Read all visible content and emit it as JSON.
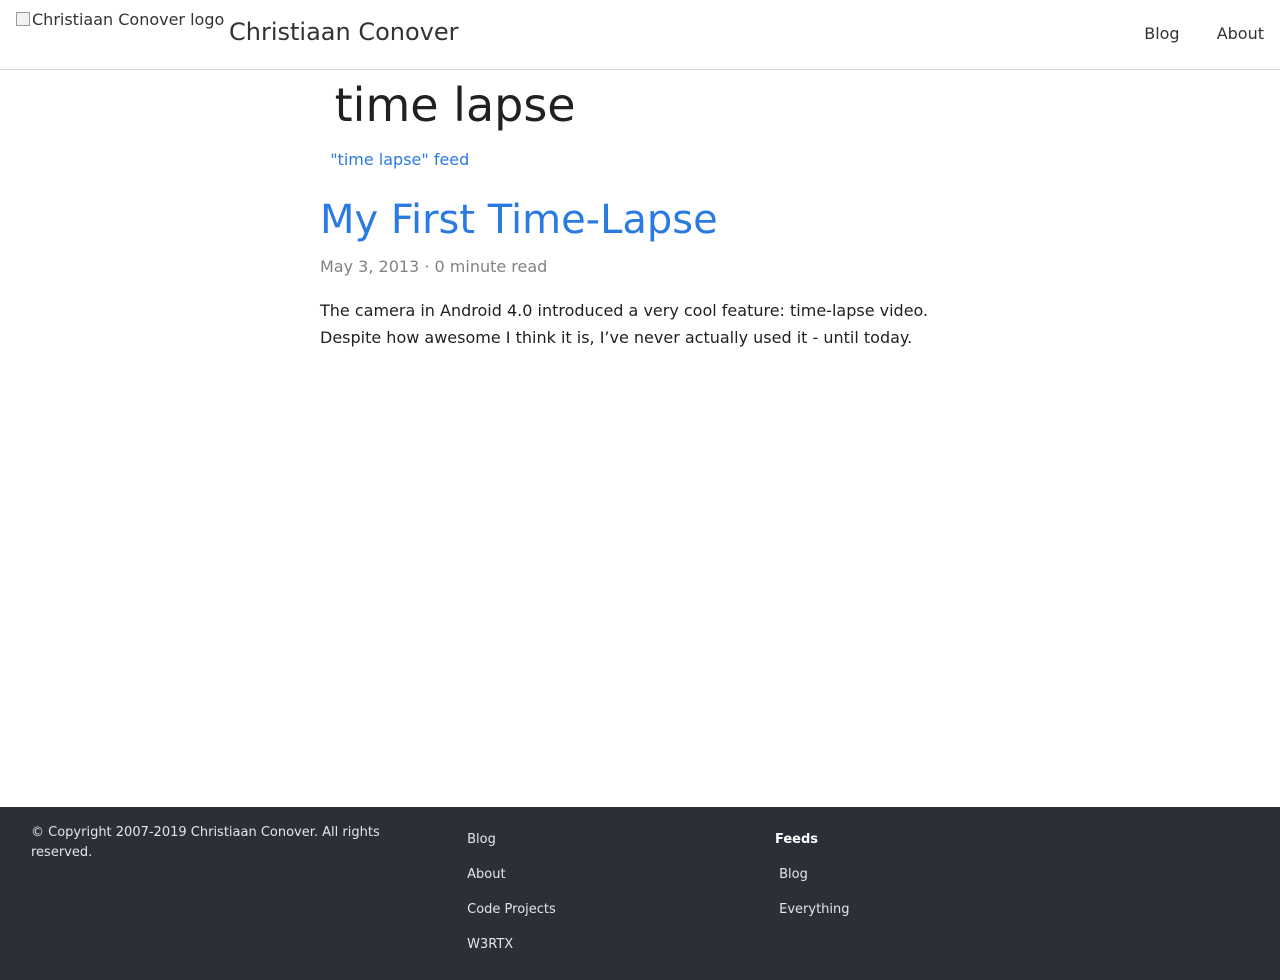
{
  "header": {
    "logo_alt": "Christiaan Conover logo",
    "site_title": "Christiaan Conover",
    "nav": [
      {
        "icon": "",
        "label": "Blog"
      },
      {
        "icon": "",
        "label": "About"
      }
    ]
  },
  "main": {
    "tag_icon": "",
    "tag_title": "time lapse",
    "feed_icon_1": "",
    "feed_icon_2": "",
    "feed_label": "\"time lapse\" feed",
    "post": {
      "title": "My First Time-Lapse",
      "date": "May 3, 2013",
      "separator": "·",
      "read_time": "0 minute read",
      "excerpt": "The camera in Android 4.0 introduced a very cool feature: time-lapse video. Despite how awesome I think it is, I’ve never actually used it - until today."
    }
  },
  "footer": {
    "copyright": "© Copyright 2007-2019 Christiaan Conover. All rights reserved.",
    "nav_links": [
      {
        "icon": "",
        "label": "Blog"
      },
      {
        "icon": "",
        "label": "About"
      },
      {
        "icon": "",
        "label": "Code Projects"
      },
      {
        "icon": "",
        "label": "W3RTX"
      }
    ],
    "feeds_heading": "Feeds",
    "feed_links": [
      {
        "icon": "",
        "label": "Blog"
      },
      {
        "icon": "",
        "label": "Everything"
      }
    ],
    "social_icons": [
      "",
      "",
      "",
      "",
      "",
      ""
    ]
  }
}
